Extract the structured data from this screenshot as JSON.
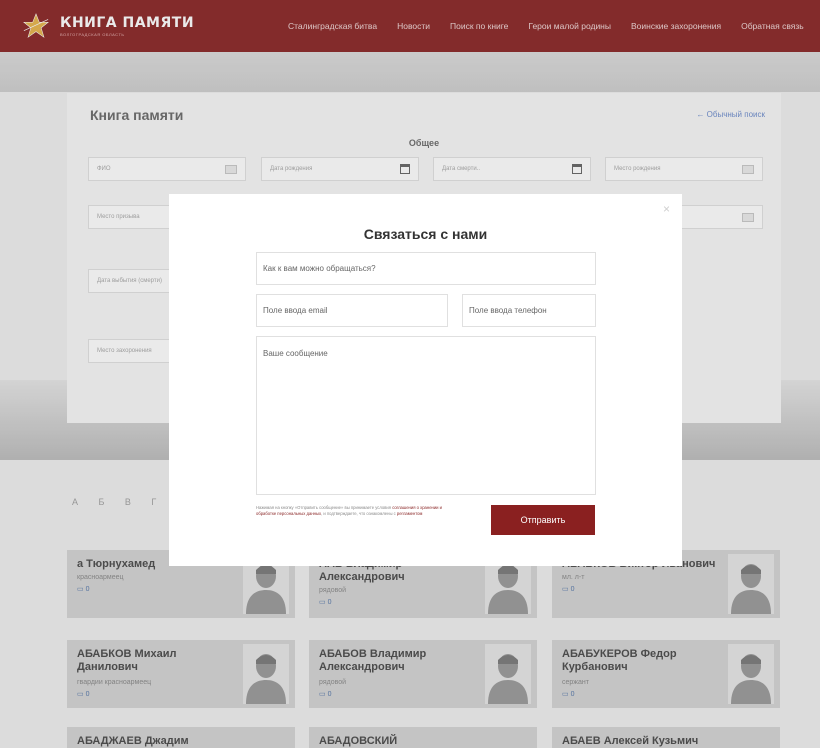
{
  "header": {
    "logo_title": "КНИГА ПАМЯТИ",
    "logo_subtitle": "ВОЛГОГРАДСКАЯ ОБЛАСТЬ",
    "nav": [
      "Сталинградская битва",
      "Новости",
      "Поиск по книге",
      "Герои малой родины",
      "Воинские захоронения",
      "Обратная связь"
    ]
  },
  "search": {
    "title": "Книга памяти",
    "back_link": "← Обычный поиск",
    "section": "Общее",
    "fields": {
      "fio": "ФИО",
      "birth_date": "Дата рождения",
      "death_date": "Дата смерти..",
      "birth_place": "Место рождения",
      "conscription_place": "Место призыва",
      "leave_date": "Дата выбытия (смерти)",
      "burial_place": "Место захоронения"
    }
  },
  "alphabet": {
    "left": "А Б В Г Д",
    "right": "Я"
  },
  "people": [
    {
      "name": "а Тюрнухамед",
      "rank": "красноармеец",
      "count": "0"
    },
    {
      "name": "ААБ Владимир Александрович",
      "rank": "рядовой",
      "count": "0"
    },
    {
      "name": "АБАБКОВ Виктор Иванович",
      "rank": "мл. л-т",
      "count": "0"
    },
    {
      "name": "АБАБКОВ Михаил Данилович",
      "rank": "гвардии красноармеец",
      "count": "0"
    },
    {
      "name": "АБАБОВ Владимир Александрович",
      "rank": "рядовой",
      "count": "0"
    },
    {
      "name": "АБАБУКЕРОВ Федор Курбанович",
      "rank": "сержант",
      "count": "0"
    },
    {
      "name": "АБАДЖАЕВ Джадим",
      "rank": "",
      "count": ""
    },
    {
      "name": "АБАДОВСКИЙ",
      "rank": "",
      "count": ""
    },
    {
      "name": "АБАЕВ Алексей Кузьмич",
      "rank": "",
      "count": ""
    }
  ],
  "modal": {
    "title": "Связаться с нами",
    "close": "×",
    "name_placeholder": "Как к вам можно обращаться?",
    "email_placeholder": "Поле ввода email",
    "phone_placeholder": "Поле ввода телефон",
    "message_placeholder": "Ваше сообщение",
    "consent_1": "Нажимая на кнопку «Отправить сообщение» вы принимаете условия",
    "consent_link_1": "соглашения о хранении и обработке персональных данных",
    "consent_2": ", и подтверждаете, что ознакомлены с",
    "consent_link_2": "регламентом",
    "submit": "Отправить"
  },
  "colors": {
    "brand": "#8a2626",
    "button": "#8a2020",
    "link": "#6d8ccc"
  }
}
